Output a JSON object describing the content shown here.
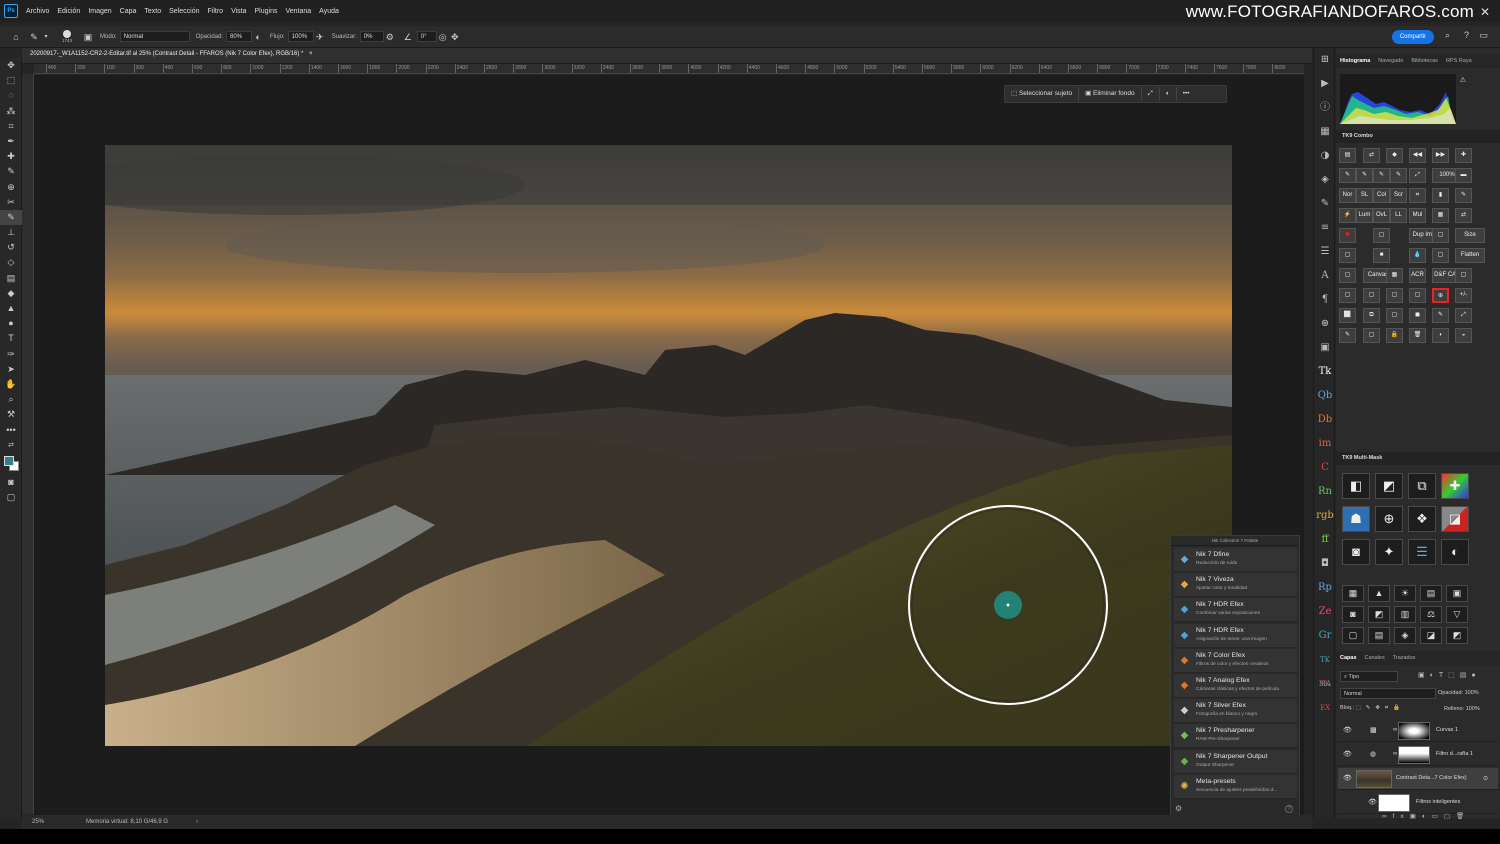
{
  "menu": {
    "app_icon": "Ps",
    "items": [
      "Archivo",
      "Edición",
      "Imagen",
      "Capa",
      "Texto",
      "Selección",
      "Filtro",
      "Vista",
      "Plugins",
      "Ventana",
      "Ayuda"
    ],
    "watermark": "www.FOTOGRAFIANDOFAROS.com",
    "close": "✕"
  },
  "options": {
    "brush_size": "1743",
    "mode_label": "Modo:",
    "mode_value": "Normal",
    "opacity_label": "Opacidad:",
    "opacity_value": "80%",
    "flow_label": "Flujo:",
    "flow_value": "100%",
    "smooth_label": "Suavizar:",
    "smooth_value": "0%",
    "angle_value": "0°",
    "share_label": "Compartir"
  },
  "document": {
    "tab_title": "20200917-_W1A1152-CR2-2-Editar.tif al 25% (Contrast Detail - FFAROS (Nik 7 Color Efex), RGB/16) *",
    "tab_close": "×",
    "ruler_ticks": [
      "400",
      "200",
      "100",
      "200",
      "400",
      "600",
      "800",
      "1000",
      "1200",
      "1400",
      "1600",
      "1800",
      "2000",
      "2200",
      "2400",
      "2600",
      "2800",
      "3000",
      "3200",
      "3400",
      "3600",
      "3800",
      "4000",
      "4200",
      "4400",
      "4600",
      "4800",
      "5000",
      "5200",
      "5400",
      "5600",
      "5800",
      "6000",
      "6200",
      "6400",
      "6600",
      "6800",
      "7000",
      "7200",
      "7400",
      "7600",
      "7800",
      "8000"
    ]
  },
  "context_bar": {
    "select_subject": "Seleccionar sujeto",
    "remove_bg": "Eliminar fondo",
    "more": "•••"
  },
  "status": {
    "zoom": "25%",
    "memory": "Memoria virtual: 8,10 G/46,9 G",
    "arrow": "›"
  },
  "nik": {
    "title": "Nik Collection 7 Palette",
    "items": [
      {
        "name": "Nik 7 Dfine",
        "desc": "Reducción de ruido",
        "icon": "◆",
        "color": "#6aa7d8"
      },
      {
        "name": "Nik 7 Viveza",
        "desc": "Ajustar color y tonalidad",
        "icon": "◆",
        "color": "#e8a53a"
      },
      {
        "name": "Nik 7 HDR Efex",
        "desc": "Combinar varias exposiciones",
        "icon": "◆",
        "color": "#4fa3d1"
      },
      {
        "name": "Nik 7 HDR Efex",
        "desc": "Asignación de tonos: una imagen",
        "icon": "◆",
        "color": "#4fa3d1"
      },
      {
        "name": "Nik 7 Color Efex",
        "desc": "Filtros de color y efectos creativos",
        "icon": "◆",
        "color": "#d07a3a"
      },
      {
        "name": "Nik 7 Analog Efex",
        "desc": "Cámaras clásicas y efectos de película",
        "icon": "◆",
        "color": "#e0702e"
      },
      {
        "name": "Nik 7 Silver Efex",
        "desc": "Fotografía en blanco y negro",
        "icon": "◆",
        "color": "#cccccc"
      },
      {
        "name": "Nik 7 Presharpener",
        "desc": "RAW Pre-Sharpener",
        "icon": "◆",
        "color": "#7ab85a"
      },
      {
        "name": "Nik 7 Sharpener Output",
        "desc": "Output Sharpener",
        "icon": "◆",
        "color": "#6fb04d"
      },
      {
        "name": "Meta-presets",
        "desc": "Secuencia de ajustes predefinidos d...",
        "icon": "✺",
        "color": "#e6b24a"
      }
    ]
  },
  "panels": {
    "histogram_tabs": [
      "Histograma",
      "Navegado",
      "Bibliotecas",
      "RPS Raya"
    ],
    "tk9_combo_title": "TK9 Combo",
    "tk9_combo_buttons": [
      "",
      "",
      "",
      "",
      "",
      "",
      "",
      "",
      "",
      "",
      "",
      "100%",
      "",
      "Nor",
      "SL",
      "Col",
      "Scr",
      "",
      "",
      "",
      "",
      "Lum",
      "OvL",
      "LL",
      "Mul",
      "",
      "",
      "",
      "",
      "Dup Img",
      "",
      "Size",
      "",
      "",
      "",
      "",
      "Flatten",
      "",
      "Canvas",
      "",
      "ACR",
      "D&F CAF",
      "",
      "",
      "",
      "",
      "",
      "",
      "+/-",
      "",
      "",
      "",
      "",
      "",
      "",
      "",
      "",
      "",
      "",
      "",
      "",
      "",
      "±C",
      "S&M",
      "",
      "TK ▸",
      "",
      "",
      "",
      "",
      "",
      ""
    ],
    "tk9_mm_title": "TK9 Multi-Mask",
    "layers_tabs": [
      "Capas",
      "Canales",
      "Trazados"
    ],
    "layers_kind": "Tipo",
    "blend_mode": "Normal",
    "opacity_label": "Opacidad:",
    "opacity_value": "100%",
    "lock_label": "Bloq.:",
    "fill_label": "Relleno:",
    "fill_value": "100%",
    "layers": [
      {
        "name": "Curvas 1"
      },
      {
        "name": "Filtro d...rafía 1"
      },
      {
        "name": "Contrast Deta...7 Color Efex)"
      },
      {
        "name": "Filtros inteligentes"
      }
    ]
  }
}
